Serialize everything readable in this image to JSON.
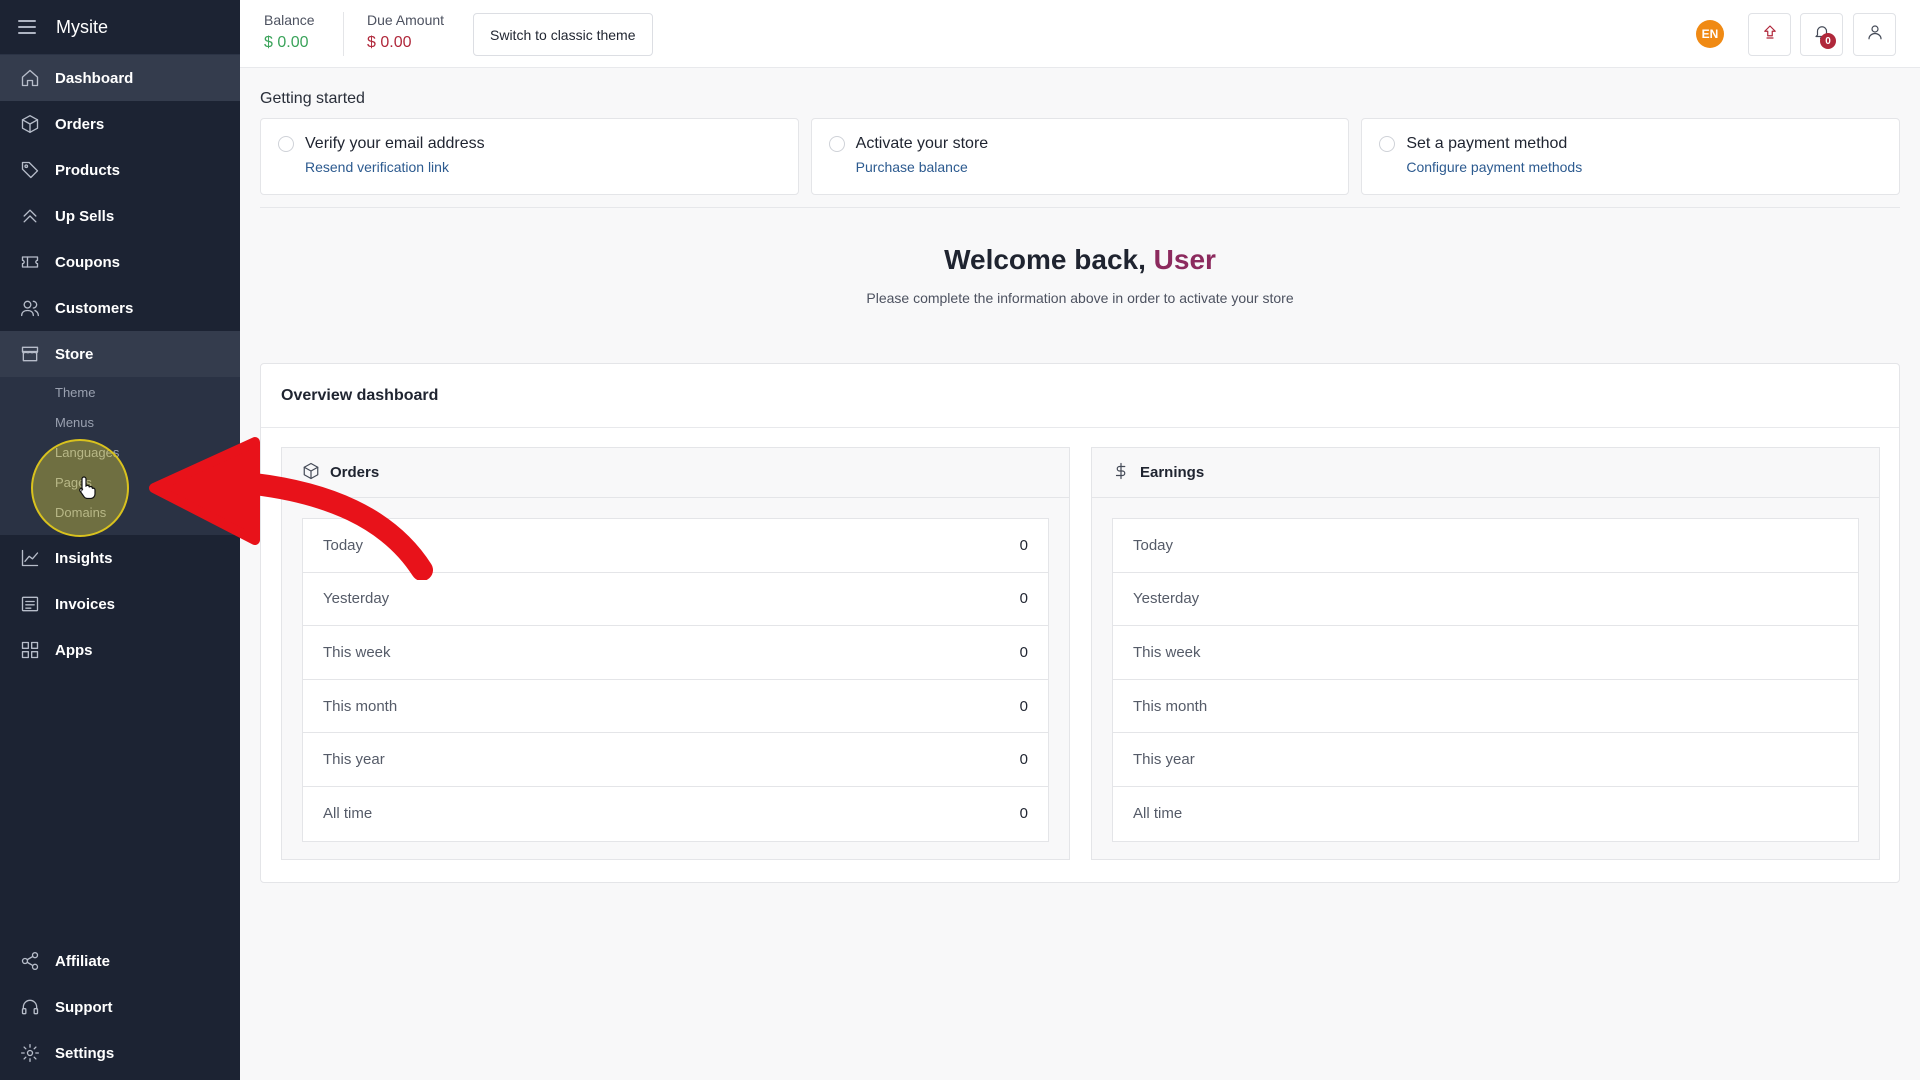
{
  "sidebar": {
    "title": "Mysite",
    "items": [
      {
        "label": "Dashboard",
        "icon": "home-icon"
      },
      {
        "label": "Orders",
        "icon": "box-icon"
      },
      {
        "label": "Products",
        "icon": "tag-icon"
      },
      {
        "label": "Up Sells",
        "icon": "chevrons-up-icon"
      },
      {
        "label": "Coupons",
        "icon": "ticket-icon"
      },
      {
        "label": "Customers",
        "icon": "users-icon"
      },
      {
        "label": "Store",
        "icon": "store-icon"
      }
    ],
    "store_subitems": [
      "Theme",
      "Menus",
      "Languages",
      "Pages",
      "Domains"
    ],
    "items_after": [
      {
        "label": "Insights",
        "icon": "chart-line-icon"
      },
      {
        "label": "Invoices",
        "icon": "invoice-icon"
      },
      {
        "label": "Apps",
        "icon": "grid-icon"
      }
    ],
    "bottom_items": [
      {
        "label": "Affiliate",
        "icon": "share-icon"
      },
      {
        "label": "Support",
        "icon": "headset-icon"
      },
      {
        "label": "Settings",
        "icon": "gear-icon"
      }
    ]
  },
  "topbar": {
    "balance_label": "Balance",
    "balance_value": "$ 0.00",
    "due_label": "Due Amount",
    "due_value": "$ 0.00",
    "theme_button": "Switch to classic theme",
    "language_badge": "EN",
    "notification_count": "0"
  },
  "getting_started": {
    "title": "Getting started",
    "steps": [
      {
        "title": "Verify your email address",
        "link": "Resend verification link"
      },
      {
        "title": "Activate your store",
        "link": "Purchase balance"
      },
      {
        "title": "Set a payment method",
        "link": "Configure payment methods"
      }
    ]
  },
  "welcome": {
    "prefix": "Welcome back, ",
    "name": "User",
    "subtitle": "Please complete the information above in order to activate your store"
  },
  "overview": {
    "title": "Overview dashboard",
    "orders": {
      "title": "Orders",
      "rows": [
        {
          "label": "Today",
          "value": "0"
        },
        {
          "label": "Yesterday",
          "value": "0"
        },
        {
          "label": "This week",
          "value": "0"
        },
        {
          "label": "This month",
          "value": "0"
        },
        {
          "label": "This year",
          "value": "0"
        },
        {
          "label": "All time",
          "value": "0"
        }
      ]
    },
    "earnings": {
      "title": "Earnings",
      "rows": [
        {
          "label": "Today",
          "value": ""
        },
        {
          "label": "Yesterday",
          "value": ""
        },
        {
          "label": "This week",
          "value": ""
        },
        {
          "label": "This month",
          "value": ""
        },
        {
          "label": "This year",
          "value": ""
        },
        {
          "label": "All time",
          "value": ""
        }
      ]
    }
  },
  "colors": {
    "sidebar_bg": "#1c2333",
    "accent_red": "#b0283b",
    "balance_green": "#3aa35a",
    "welcome_name": "#8c2a5e",
    "link_blue": "#2c5a8f",
    "annotation_arrow": "#e8121a",
    "highlight_yellow": "#f0e13c"
  }
}
